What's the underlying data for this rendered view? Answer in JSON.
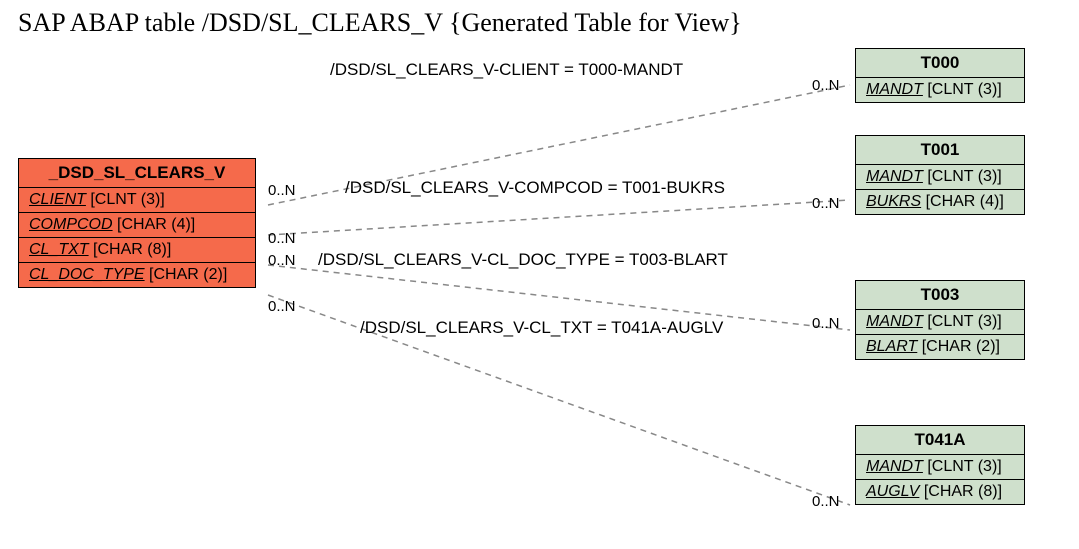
{
  "title": "SAP ABAP table /DSD/SL_CLEARS_V {Generated Table for View}",
  "mainEntity": {
    "name": "_DSD_SL_CLEARS_V",
    "fields": [
      {
        "name": "CLIENT",
        "type": "[CLNT (3)]"
      },
      {
        "name": "COMPCOD",
        "type": "[CHAR (4)]"
      },
      {
        "name": "CL_TXT",
        "type": "[CHAR (8)]"
      },
      {
        "name": "CL_DOC_TYPE",
        "type": "[CHAR (2)]"
      }
    ]
  },
  "targets": [
    {
      "name": "T000",
      "fields": [
        {
          "name": "MANDT",
          "type": "[CLNT (3)]"
        }
      ]
    },
    {
      "name": "T001",
      "fields": [
        {
          "name": "MANDT",
          "type": "[CLNT (3)]"
        },
        {
          "name": "BUKRS",
          "type": "[CHAR (4)]"
        }
      ]
    },
    {
      "name": "T003",
      "fields": [
        {
          "name": "MANDT",
          "type": "[CLNT (3)]"
        },
        {
          "name": "BLART",
          "type": "[CHAR (2)]"
        }
      ]
    },
    {
      "name": "T041A",
      "fields": [
        {
          "name": "MANDT",
          "type": "[CLNT (3)]"
        },
        {
          "name": "AUGLV",
          "type": "[CHAR (8)]"
        }
      ]
    }
  ],
  "relations": [
    {
      "label": "/DSD/SL_CLEARS_V-CLIENT = T000-MANDT"
    },
    {
      "label": "/DSD/SL_CLEARS_V-COMPCOD = T001-BUKRS"
    },
    {
      "label": "/DSD/SL_CLEARS_V-CL_DOC_TYPE = T003-BLART"
    },
    {
      "label": "/DSD/SL_CLEARS_V-CL_TXT = T041A-AUGLV"
    }
  ],
  "card": "0..N"
}
